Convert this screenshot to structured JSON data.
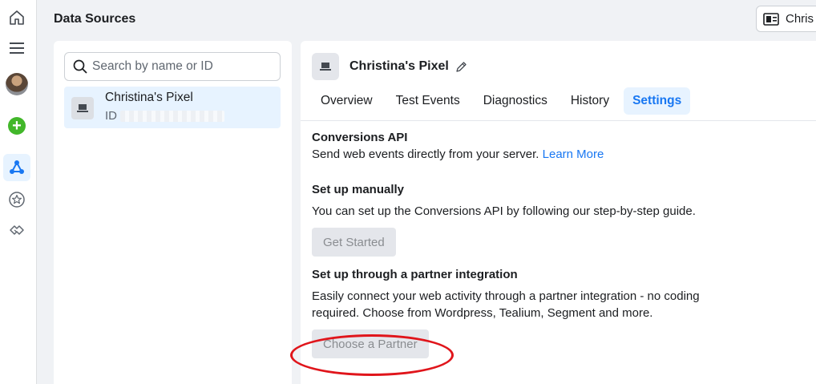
{
  "header": {
    "title": "Data Sources",
    "account_label": "Chris"
  },
  "rail": {
    "icons": [
      "home-icon",
      "menu-icon",
      "avatar",
      "add-icon",
      "data-sources-icon",
      "star-icon",
      "handshake-icon"
    ]
  },
  "sidebar": {
    "search_placeholder": "Search by name or ID",
    "items": [
      {
        "name": "Christina's Pixel",
        "id_label": "ID"
      }
    ]
  },
  "detail": {
    "pixel_name": "Christina's Pixel",
    "tabs": [
      {
        "label": "Overview"
      },
      {
        "label": "Test Events"
      },
      {
        "label": "Diagnostics"
      },
      {
        "label": "History"
      },
      {
        "label": "Settings"
      }
    ],
    "active_tab": "Settings",
    "conversions_api": {
      "title": "Conversions API",
      "description": "Send web events directly from your server.",
      "learn_more": "Learn More"
    },
    "manual": {
      "title": "Set up manually",
      "description": "You can set up the Conversions API by following our step-by-step guide.",
      "button": "Get Started"
    },
    "partner": {
      "title": "Set up through a partner integration",
      "description_line1": "Easily connect your web activity through a partner integration - no coding",
      "description_line2": "required. Choose from Wordpress, Tealium, Segment and more.",
      "button": "Choose a Partner"
    }
  },
  "colors": {
    "accent": "#1877f2",
    "active_bg": "#e7f3ff",
    "highlight": "#e0151b",
    "add_green": "#42b72a"
  }
}
